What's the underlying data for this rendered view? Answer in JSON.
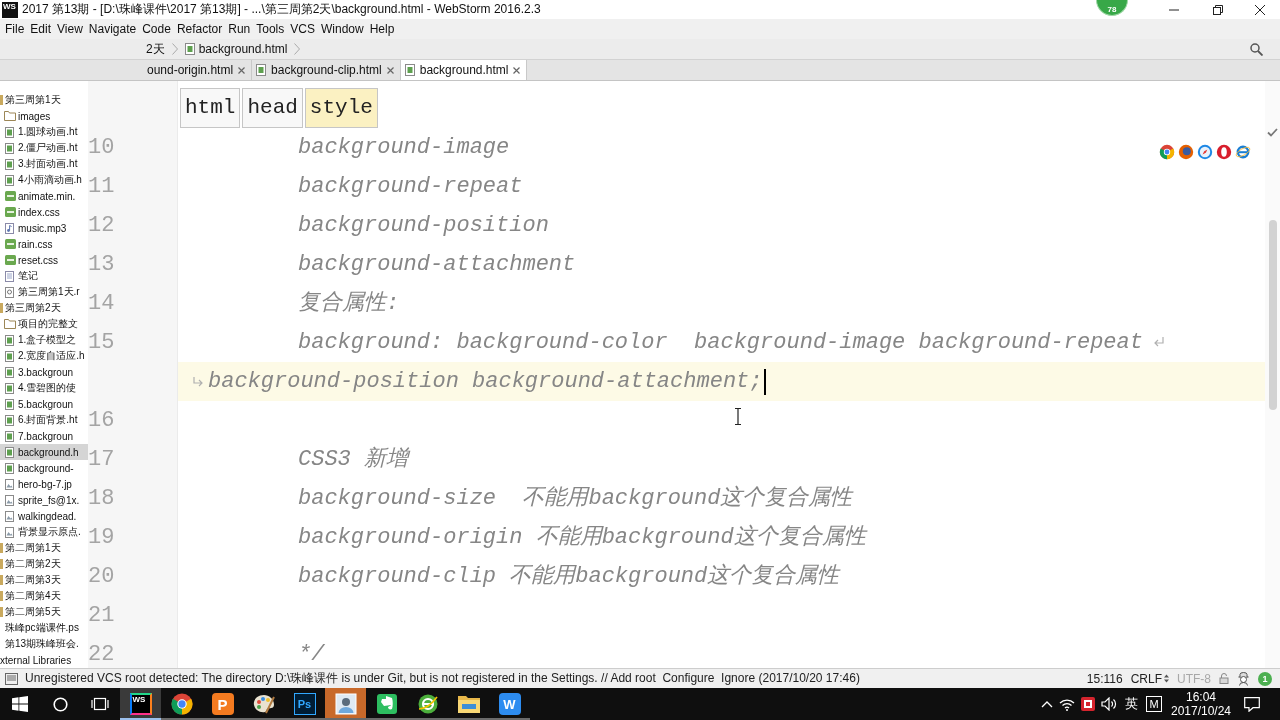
{
  "window": {
    "icon_label": "WS",
    "title": "2017 第13期 - [D:\\珠峰课件\\2017 第13期] - ...\\第三周第2天\\background.html - WebStorm 2016.2.3",
    "badge": "78"
  },
  "menu": [
    "File",
    "Edit",
    "View",
    "Navigate",
    "Code",
    "Refactor",
    "Run",
    "Tools",
    "VCS",
    "Window",
    "Help"
  ],
  "navigation_bar": {
    "crumbs": [
      {
        "label": "2天",
        "show_icon": false
      },
      {
        "label": "background.html",
        "show_icon": true
      }
    ]
  },
  "tabs": [
    {
      "label": "ound-origin.html",
      "show_icon": false,
      "selected": false
    },
    {
      "label": "background-clip.html",
      "show_icon": true,
      "selected": false
    },
    {
      "label": "background.html",
      "show_icon": true,
      "selected": true
    }
  ],
  "sidebar": {
    "tree": [
      {
        "label": "第三周第1天",
        "kind": "folder",
        "selected": false,
        "children": [
          {
            "label": "images",
            "kind": "folder",
            "selected": false
          },
          {
            "label": "1.圆球动画.ht",
            "kind": "html",
            "selected": false
          },
          {
            "label": "2.僵尸动画.ht",
            "kind": "html",
            "selected": false
          },
          {
            "label": "3.封面动画.ht",
            "kind": "html",
            "selected": false
          },
          {
            "label": "4小雨滴动画.h",
            "kind": "html",
            "selected": false
          },
          {
            "label": "animate.min.",
            "kind": "css",
            "selected": false
          },
          {
            "label": "index.css",
            "kind": "css",
            "selected": false
          },
          {
            "label": "music.mp3",
            "kind": "audio",
            "selected": false
          },
          {
            "label": "rain.css",
            "kind": "css",
            "selected": false
          },
          {
            "label": "reset.css",
            "kind": "css",
            "selected": false
          },
          {
            "label": "笔记",
            "kind": "text",
            "selected": false
          },
          {
            "label": "第三周第1天.r",
            "kind": "unknown",
            "selected": false
          }
        ]
      },
      {
        "label": "第三周第2天",
        "kind": "folder",
        "selected": false,
        "children": [
          {
            "label": "项目的完整文",
            "kind": "folder",
            "selected": false
          },
          {
            "label": "1.盒子模型之",
            "kind": "html",
            "selected": false
          },
          {
            "label": "2.宽度自适应.h",
            "kind": "html",
            "selected": false
          },
          {
            "label": "3.backgroun",
            "kind": "html",
            "selected": false
          },
          {
            "label": "4.雪碧图的使",
            "kind": "html",
            "selected": false
          },
          {
            "label": "5.backgroun",
            "kind": "html",
            "selected": false
          },
          {
            "label": "6.封面背景.ht",
            "kind": "html",
            "selected": false
          },
          {
            "label": "7.backgroun",
            "kind": "html",
            "selected": false
          },
          {
            "label": "background.h",
            "kind": "html",
            "selected": true
          },
          {
            "label": "background-",
            "kind": "html",
            "selected": false
          },
          {
            "label": "hero-bg-7.jp",
            "kind": "image",
            "selected": false
          },
          {
            "label": "sprite_fs@1x.",
            "kind": "image",
            "selected": false
          },
          {
            "label": "walkingdead.",
            "kind": "image",
            "selected": false
          },
          {
            "label": "背景显示原点.",
            "kind": "image",
            "selected": false
          }
        ]
      },
      {
        "label": "第二周第1天",
        "kind": "folder",
        "selected": false
      },
      {
        "label": "第二周第2天",
        "kind": "folder",
        "selected": false
      },
      {
        "label": "第二周第3天",
        "kind": "folder",
        "selected": false
      },
      {
        "label": "第二周第4天",
        "kind": "folder",
        "selected": false
      },
      {
        "label": "第二周第5天",
        "kind": "folder",
        "selected": false
      },
      {
        "label": "珠峰pc端课件.ps",
        "kind": "file",
        "selected": false
      },
      {
        "label": "第13期珠峰班会.",
        "kind": "file",
        "selected": false
      }
    ],
    "libraries_item": {
      "label": "xternal Libraries",
      "selected": false
    }
  },
  "editor": {
    "tag_path": [
      {
        "label": "html",
        "selected": false
      },
      {
        "label": "head",
        "selected": false
      },
      {
        "label": "style",
        "selected": true
      }
    ],
    "rows": [
      {
        "kind": "line",
        "number": "10",
        "text": "background-image",
        "wrapped": false,
        "current": false
      },
      {
        "kind": "line",
        "number": "11",
        "text": "background-repeat",
        "wrapped": false,
        "current": false
      },
      {
        "kind": "line",
        "number": "12",
        "text": "background-position",
        "wrapped": false,
        "current": false
      },
      {
        "kind": "line",
        "number": "13",
        "text": "background-attachment",
        "wrapped": false,
        "current": false
      },
      {
        "kind": "line",
        "number": "14",
        "text": "复合属性:",
        "wrapped": false,
        "current": false
      },
      {
        "kind": "line",
        "number": "15",
        "text": "background: background-color  background-image background-repeat",
        "wrapped": true,
        "current": false
      },
      {
        "kind": "continuation",
        "text": "background-position background-attachment;",
        "wrapped": false,
        "current": true
      },
      {
        "kind": "line",
        "number": "16",
        "wrapped": false,
        "current": false
      },
      {
        "kind": "line",
        "number": "17",
        "text": "CSS3 新增",
        "wrapped": false,
        "current": false
      },
      {
        "kind": "line",
        "number": "18",
        "text": "background-size  不能用background这个复合属性",
        "wrapped": false,
        "current": false
      },
      {
        "kind": "line",
        "number": "19",
        "text": "background-origin 不能用background这个复合属性",
        "wrapped": false,
        "current": false
      },
      {
        "kind": "line",
        "number": "20",
        "text": "background-clip 不能用background这个复合属性",
        "wrapped": false,
        "current": false
      },
      {
        "kind": "line",
        "number": "21",
        "wrapped": false,
        "current": false
      },
      {
        "kind": "line",
        "number": "22",
        "text": "*/",
        "wrapped": false,
        "current": false
      }
    ]
  },
  "status_bar": {
    "message": "Unregistered VCS root detected: The directory D:\\珠峰课件 is under Git, but is not registered in the Settings. // Add root  Configure  Ignore (2017/10/20 17:46)",
    "position": "15:116",
    "line_separator": "CRLF",
    "encoding": {
      "label": "UTF-8",
      "disabled": true
    },
    "event_count": "1"
  },
  "taskbar": {
    "apps": [
      {
        "kind": "ws",
        "label": "WS",
        "selected": true,
        "flashing": false
      },
      {
        "kind": "chrome",
        "selected": false,
        "flashing": false
      },
      {
        "kind": "p_tile",
        "label": "P",
        "selected": false,
        "flashing": false
      },
      {
        "kind": "palette",
        "selected": false,
        "flashing": false
      },
      {
        "kind": "ps",
        "label": "Ps",
        "selected": false,
        "flashing": false
      },
      {
        "kind": "portrait",
        "selected": false,
        "flashing": true
      },
      {
        "kind": "evernote",
        "selected": false,
        "flashing": false
      },
      {
        "kind": "globe",
        "selected": false,
        "flashing": false
      },
      {
        "kind": "folder",
        "selected": false,
        "flashing": false
      },
      {
        "kind": "w_tile",
        "label": "W",
        "selected": false,
        "flashing": false
      }
    ],
    "tray": {
      "input_language": "英",
      "ime_mode": "M",
      "time": "16:04",
      "date": "2017/10/24"
    }
  }
}
